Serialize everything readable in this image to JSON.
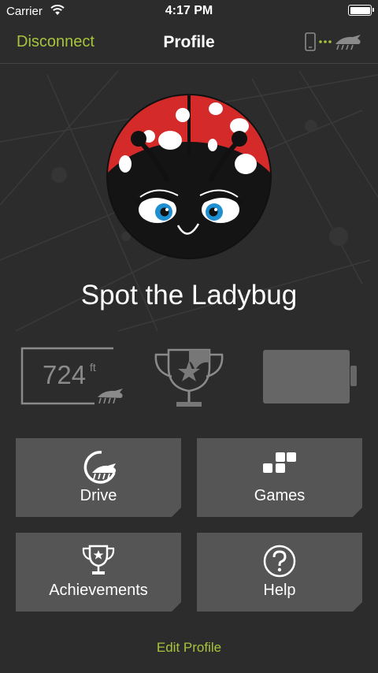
{
  "status_bar": {
    "carrier": "Carrier",
    "time": "4:17 PM"
  },
  "nav": {
    "left_label": "Disconnect",
    "title": "Profile"
  },
  "profile": {
    "name": "Spot the Ladybug"
  },
  "stats": {
    "distance_value": "724",
    "distance_unit": "ft"
  },
  "tiles": [
    {
      "label": "Drive",
      "icon": "drive-icon"
    },
    {
      "label": "Games",
      "icon": "games-icon"
    },
    {
      "label": "Achievements",
      "icon": "trophy-icon"
    },
    {
      "label": "Help",
      "icon": "help-icon"
    }
  ],
  "footer": {
    "edit_profile_label": "Edit Profile"
  },
  "colors": {
    "accent": "#a7c43b",
    "background": "#2c2c2c",
    "tile": "#555555",
    "ladybug_red": "#d42a2a"
  }
}
